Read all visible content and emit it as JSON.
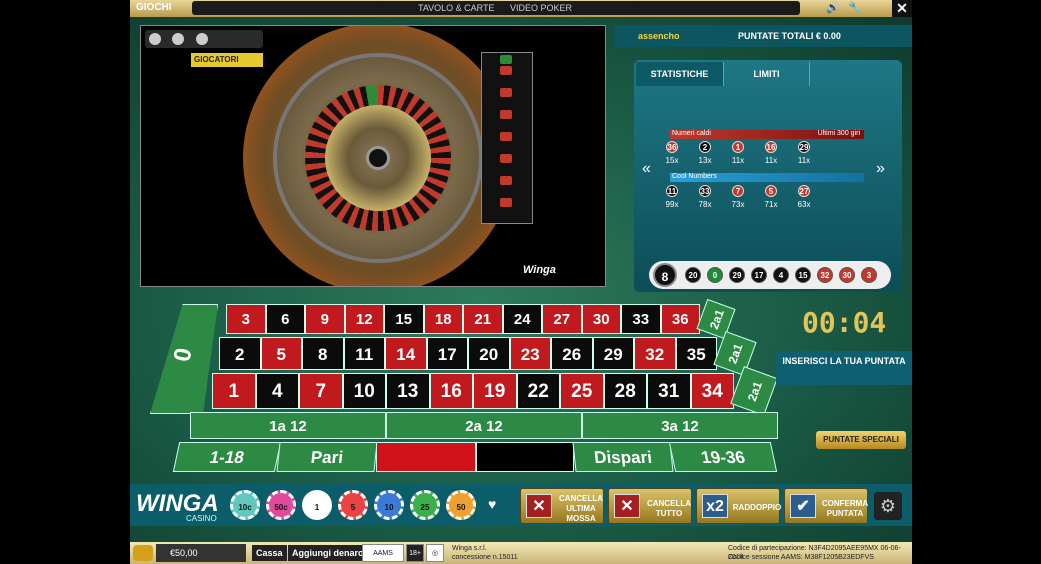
{
  "topbar": {
    "logo": "GIOCHI",
    "menu": [
      "TAVOLO & CARTE",
      "VIDEO POKER"
    ]
  },
  "video": {
    "players_label": "GIOCATORI",
    "logo": "Winga"
  },
  "header": {
    "username": "assencho",
    "total_bets": "PUNTATE TOTALI € 0.00"
  },
  "stats": {
    "tabs": [
      "STATISTICHE",
      "LIMITI"
    ],
    "hot_title": "Numeri caldi",
    "hot_range": "Ultimi 300 giri",
    "hot": [
      {
        "n": "36",
        "c": "red",
        "count": "15x"
      },
      {
        "n": "2",
        "c": "black",
        "count": "13x"
      },
      {
        "n": "1",
        "c": "red",
        "count": "11x"
      },
      {
        "n": "16",
        "c": "red",
        "count": "11x"
      },
      {
        "n": "29",
        "c": "black",
        "count": "11x"
      }
    ],
    "cool_title": "Cool Numbers",
    "cool": [
      {
        "n": "11",
        "c": "black",
        "count": "99x"
      },
      {
        "n": "33",
        "c": "black",
        "count": "78x"
      },
      {
        "n": "7",
        "c": "red",
        "count": "73x"
      },
      {
        "n": "5",
        "c": "red",
        "count": "71x"
      },
      {
        "n": "27",
        "c": "red",
        "count": "63x"
      }
    ],
    "last_number": "8",
    "recent": [
      {
        "n": "20",
        "c": "black"
      },
      {
        "n": "0",
        "c": "green"
      },
      {
        "n": "29",
        "c": "black"
      },
      {
        "n": "17",
        "c": "black"
      },
      {
        "n": "4",
        "c": "black"
      },
      {
        "n": "15",
        "c": "black"
      },
      {
        "n": "32",
        "c": "red"
      },
      {
        "n": "30",
        "c": "red"
      },
      {
        "n": "3",
        "c": "red"
      }
    ]
  },
  "table": {
    "zero": "0",
    "rows": [
      [
        {
          "n": "3",
          "c": "red"
        },
        {
          "n": "6",
          "c": "black"
        },
        {
          "n": "9",
          "c": "red"
        },
        {
          "n": "12",
          "c": "red"
        },
        {
          "n": "15",
          "c": "black"
        },
        {
          "n": "18",
          "c": "red"
        },
        {
          "n": "21",
          "c": "red"
        },
        {
          "n": "24",
          "c": "black"
        },
        {
          "n": "27",
          "c": "red"
        },
        {
          "n": "30",
          "c": "red"
        },
        {
          "n": "33",
          "c": "black"
        },
        {
          "n": "36",
          "c": "red"
        }
      ],
      [
        {
          "n": "2",
          "c": "black"
        },
        {
          "n": "5",
          "c": "red"
        },
        {
          "n": "8",
          "c": "black"
        },
        {
          "n": "11",
          "c": "black"
        },
        {
          "n": "14",
          "c": "red"
        },
        {
          "n": "17",
          "c": "black"
        },
        {
          "n": "20",
          "c": "black"
        },
        {
          "n": "23",
          "c": "red"
        },
        {
          "n": "26",
          "c": "black"
        },
        {
          "n": "29",
          "c": "black"
        },
        {
          "n": "32",
          "c": "red"
        },
        {
          "n": "35",
          "c": "black"
        }
      ],
      [
        {
          "n": "1",
          "c": "red"
        },
        {
          "n": "4",
          "c": "black"
        },
        {
          "n": "7",
          "c": "red"
        },
        {
          "n": "10",
          "c": "black"
        },
        {
          "n": "13",
          "c": "black"
        },
        {
          "n": "16",
          "c": "red"
        },
        {
          "n": "19",
          "c": "red"
        },
        {
          "n": "22",
          "c": "black"
        },
        {
          "n": "25",
          "c": "red"
        },
        {
          "n": "28",
          "c": "black"
        },
        {
          "n": "31",
          "c": "black"
        },
        {
          "n": "34",
          "c": "red"
        }
      ]
    ],
    "column_bet": "2a1",
    "dozens": [
      "1a 12",
      "2a 12",
      "3a 12"
    ],
    "outside": {
      "low": "1-18",
      "even": "Pari",
      "odd": "Dispari",
      "high": "19-36"
    }
  },
  "timer": "00:04",
  "prompt": "INSERISCI LA TUA PUNTATA",
  "special_bets": "PUNTATE SPECIALI",
  "chips": [
    {
      "label": "10c",
      "color": "#5fc9c0"
    },
    {
      "label": "50c",
      "color": "#e04a9c"
    },
    {
      "label": "1",
      "color": "#ffffff"
    },
    {
      "label": "5",
      "color": "#e84444"
    },
    {
      "label": "10",
      "color": "#3a7ad8"
    },
    {
      "label": "25",
      "color": "#3bb04a"
    },
    {
      "label": "50",
      "color": "#f0a030"
    }
  ],
  "brand": {
    "name": "WINGA",
    "sub": "CASINO"
  },
  "actions": {
    "cancel_last": "CANCELLA ULTIMA MOSSA",
    "cancel_all": "CANCELLA TUTTO",
    "double": "RADDOPPIO",
    "double_icon": "x2",
    "confirm": "CONFERMA PUNTATA"
  },
  "footer": {
    "balance": "€50,00",
    "cashier": "Cassa",
    "add_money": "Aggiungi denaro",
    "badge_age": "18+",
    "company": "Winga s.r.l.",
    "concession": "concessione n.15011",
    "participation_code": "Codice di partecipazione: N3F4D2095AEE95MX 06-06-2014",
    "session_code": "Codice sessione AAMS: M38F1205B23EDFVS"
  }
}
